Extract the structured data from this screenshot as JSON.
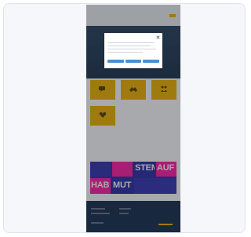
{
  "site": {
    "logo": "",
    "section_title": "",
    "tiles": [
      {
        "caption": ""
      },
      {
        "caption": ""
      },
      {
        "caption": ""
      },
      {
        "caption": ""
      }
    ]
  },
  "social": {
    "title": "",
    "collage": [
      {
        "text": ""
      },
      {
        "text": ""
      },
      {
        "text": "STEM"
      },
      {
        "text": "AUF"
      },
      {
        "text": "HAB"
      },
      {
        "text": "MUT"
      },
      {
        "text": ""
      }
    ]
  },
  "modal": {
    "title": ""
  },
  "colors": {
    "accent_yellow": "#f0b400",
    "hero_blue": "#203852",
    "footer_blue": "#172f4f",
    "collage_magenta": "#ff1fa5",
    "collage_blue": "#2e2ea6",
    "modal_blue": "#4b8fd0"
  }
}
